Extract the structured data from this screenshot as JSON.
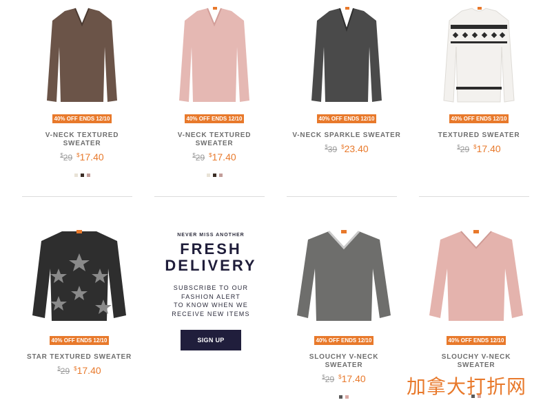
{
  "products": [
    {
      "badge": "40% OFF ENDS 12/10",
      "name": "V-NECK TEXTURED SWEATER",
      "old_price": "29",
      "price": "17.40",
      "swatches": [
        "#e8e2d6",
        "#3b2e26",
        "#c39e9a"
      ]
    },
    {
      "badge": "40% OFF ENDS 12/10",
      "name": "V-NECK TEXTURED SWEATER",
      "old_price": "29",
      "price": "17.40",
      "swatches": [
        "#e8e2d6",
        "#3b2e26",
        "#c39e9a"
      ]
    },
    {
      "badge": "40% OFF ENDS 12/10",
      "name": "V-NECK SPARKLE SWEATER",
      "old_price": "39",
      "price": "23.40",
      "swatches": []
    },
    {
      "badge": "40% OFF ENDS 12/10",
      "name": "TEXTURED SWEATER",
      "old_price": "29",
      "price": "17.40",
      "swatches": []
    },
    {
      "badge": "40% OFF ENDS 12/10",
      "name": "STAR TEXTURED SWEATER",
      "old_price": "29",
      "price": "17.40",
      "swatches": []
    },
    {
      "badge": "40% OFF ENDS 12/10",
      "name": "SLOUCHY V-NECK SWEATER",
      "old_price": "29",
      "price": "17.40",
      "swatches": [
        "#5a5a5a",
        "#d9a9a4"
      ]
    },
    {
      "badge": "40% OFF ENDS 12/10",
      "name": "SLOUCHY V-NECK SWEATER",
      "old_price": "",
      "price": "",
      "swatches": [
        "#5a5a5a",
        "#d9a9a4"
      ]
    }
  ],
  "promo": {
    "eyebrow": "NEVER MISS ANOTHER",
    "headline_1": "FRESH",
    "headline_2": "DELIVERY",
    "sub_1": "SUBSCRIBE TO OUR",
    "sub_2": "FASHION ALERT",
    "sub_3": "TO KNOW WHEN WE",
    "sub_4": "RECEIVE NEW ITEMS",
    "button": "SIGN UP"
  },
  "currency": "$",
  "watermark": "加拿大打折网",
  "colors": {
    "accent": "#e8792b",
    "navy": "#201e3c"
  }
}
